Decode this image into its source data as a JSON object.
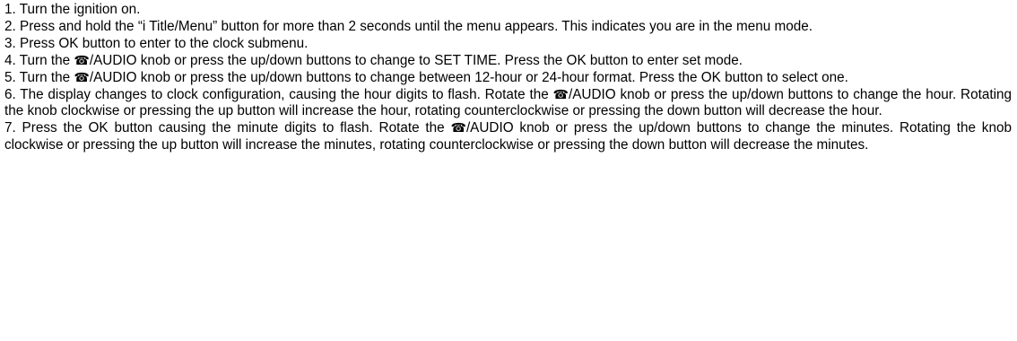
{
  "instructions": {
    "steps": [
      {
        "parts": [
          "1. Turn the ignition on."
        ]
      },
      {
        "parts": [
          "2. Press and hold the “i Title/Menu” button for more than 2 seconds until the menu appears. This indicates you are in the menu mode."
        ]
      },
      {
        "parts": [
          "3. Press OK button to enter to the clock submenu."
        ]
      },
      {
        "parts": [
          "4. Turn the ",
          "/AUDIO knob or press the up/down buttons to change to SET TIME. Press the OK button to enter set mode."
        ]
      },
      {
        "parts": [
          "5. Turn the ",
          "/AUDIO knob or press the up/down buttons to change between 12-hour or 24-hour format. Press the OK button to select one."
        ]
      },
      {
        "parts": [
          "6. The display changes to clock configuration, causing the hour digits to flash. Rotate the ",
          "/AUDIO knob or press the up/down buttons to change the hour. Rotating the knob clockwise or pressing the up button will increase the hour, rotating counterclockwise or pressing the down button will decrease the hour."
        ]
      },
      {
        "parts": [
          "7. Press the OK button causing the minute digits to flash. Rotate the ",
          "/AUDIO knob or press the up/down buttons to change the minutes. Rotating the knob clockwise or pressing the up button will increase the minutes, rotating counterclockwise or pressing the down button will decrease the minutes."
        ]
      }
    ],
    "phone_glyph": "☎",
    "icon_name": "telephone-icon"
  }
}
